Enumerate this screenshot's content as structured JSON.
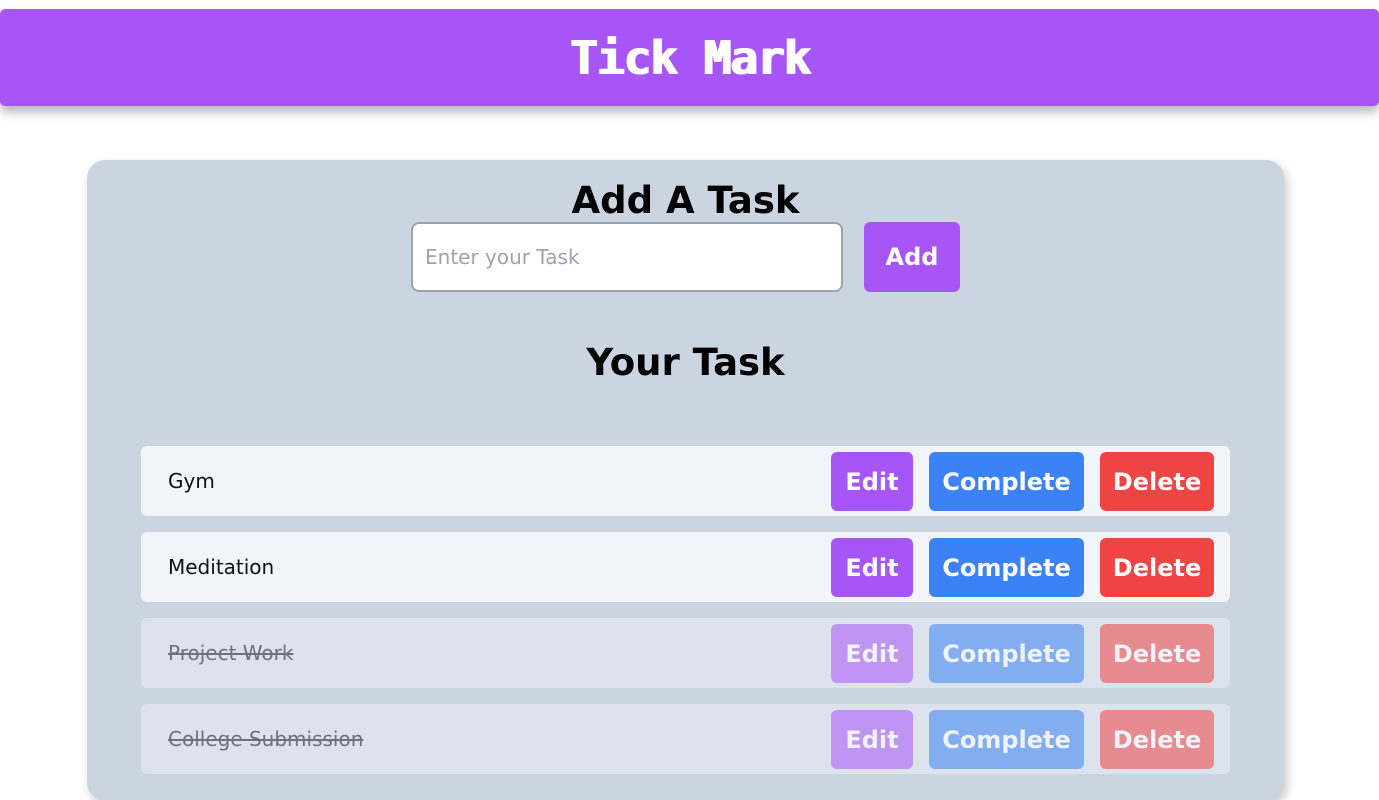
{
  "app": {
    "title": "Tick Mark"
  },
  "add_section": {
    "heading": "Add A Task",
    "input_placeholder": "Enter your Task",
    "input_value": "",
    "add_label": "Add"
  },
  "list_section": {
    "heading": "Your Task",
    "tasks": [
      {
        "text": "Gym",
        "completed": false,
        "edit_label": "Edit",
        "complete_label": "Complete",
        "delete_label": "Delete"
      },
      {
        "text": "Meditation",
        "completed": false,
        "edit_label": "Edit",
        "complete_label": "Complete",
        "delete_label": "Delete"
      },
      {
        "text": "Project Work",
        "completed": true,
        "edit_label": "Edit",
        "complete_label": "Complete",
        "delete_label": "Delete"
      },
      {
        "text": "College Submission",
        "completed": true,
        "edit_label": "Edit",
        "complete_label": "Complete",
        "delete_label": "Delete"
      }
    ]
  },
  "colors": {
    "brand": "#a855f7",
    "complete": "#3b82f6",
    "delete": "#ef4444",
    "card": "#cbd5e1",
    "row": "#f1f5f9"
  }
}
